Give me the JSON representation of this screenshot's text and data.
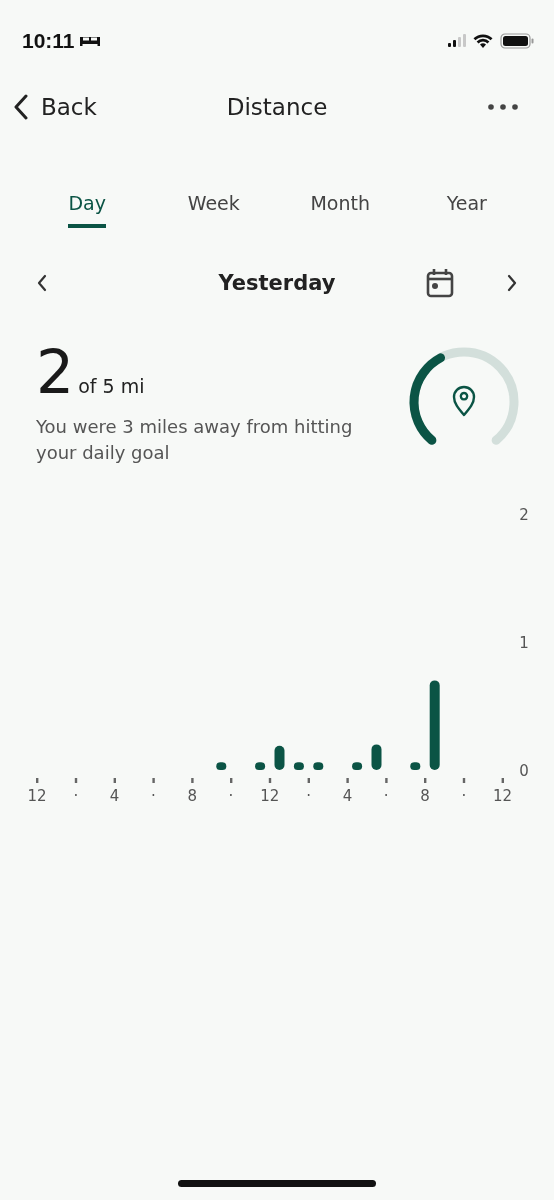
{
  "status_bar": {
    "time": "10:11"
  },
  "nav": {
    "back": "Back",
    "title": "Distance"
  },
  "tabs": [
    {
      "label": "Day",
      "selected": true
    },
    {
      "label": "Week",
      "selected": false
    },
    {
      "label": "Month",
      "selected": false
    },
    {
      "label": "Year",
      "selected": false
    }
  ],
  "date_nav": {
    "label": "Yesterday"
  },
  "summary": {
    "value": "2",
    "goal": "of 5 mi",
    "message": "You were 3 miles away from hitting your daily goal"
  },
  "chart": {
    "y_axis_labels": [
      "2",
      "1",
      "0"
    ],
    "x_axis_labels": [
      "12",
      "·",
      "4",
      "·",
      "8",
      "·",
      "12",
      "·",
      "4",
      "·",
      "8",
      "·",
      "12"
    ]
  }
}
